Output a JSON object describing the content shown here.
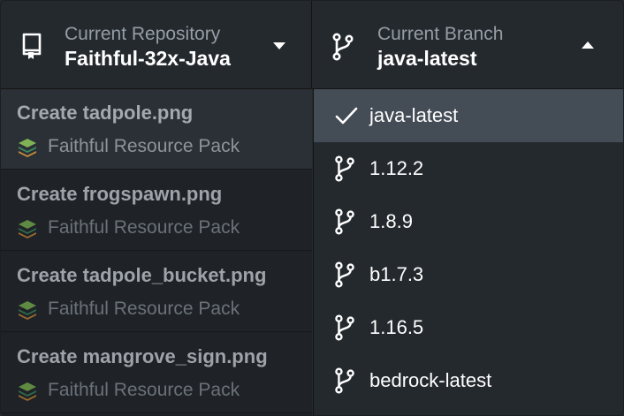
{
  "repository": {
    "title": "Current Repository",
    "value": "Faithful-32x-Java",
    "icon": "repo-icon",
    "caret": "chevron-down-icon"
  },
  "branch": {
    "title": "Current Branch",
    "value": "java-latest",
    "icon": "branch-icon",
    "caret": "chevron-up-icon"
  },
  "commits": [
    {
      "title": "Create tadpole.png",
      "author": "Faithful Resource Pack"
    },
    {
      "title": "Create frogspawn.png",
      "author": "Faithful Resource Pack"
    },
    {
      "title": "Create tadpole_bucket.png",
      "author": "Faithful Resource Pack"
    },
    {
      "title": "Create mangrove_sign.png",
      "author": "Faithful Resource Pack"
    }
  ],
  "branches": [
    {
      "label": "java-latest",
      "selected": true,
      "icon": "check-icon"
    },
    {
      "label": "1.12.2",
      "selected": false,
      "icon": "branch-icon"
    },
    {
      "label": "1.8.9",
      "selected": false,
      "icon": "branch-icon"
    },
    {
      "label": "b1.7.3",
      "selected": false,
      "icon": "branch-icon"
    },
    {
      "label": "1.16.5",
      "selected": false,
      "icon": "branch-icon"
    },
    {
      "label": "bedrock-latest",
      "selected": false,
      "icon": "branch-icon"
    }
  ],
  "colors": {
    "background": "#24292e",
    "selected_row": "#444c56",
    "text": "#ffffff",
    "muted": "#959da5"
  }
}
